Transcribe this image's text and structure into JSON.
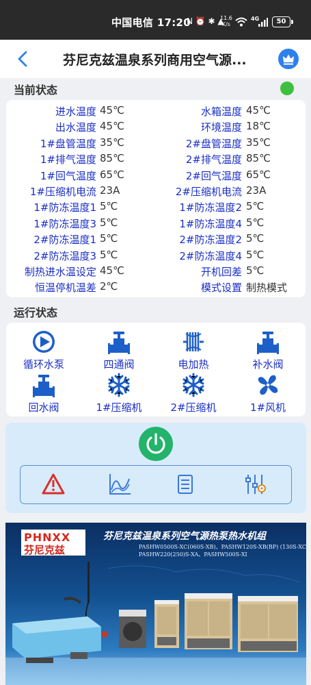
{
  "status_bar": {
    "carrier_time": "中国电信 17:20",
    "icons": "N ⏰ ✱ ▲",
    "speed_value": "11.6",
    "speed_unit": "K/s",
    "network": "4G",
    "battery": "50"
  },
  "app_bar": {
    "title": "芬尼克兹温泉系列商用空气源..."
  },
  "current_status": {
    "label": "当前状态",
    "indicator_color": "#3fbf3f",
    "rows": [
      {
        "left_label": "进水温度",
        "left_value": "45℃",
        "right_label": "水箱温度",
        "right_value": "45℃"
      },
      {
        "left_label": "出水温度",
        "left_value": "45℃",
        "right_label": "环境温度",
        "right_value": "18℃"
      },
      {
        "left_label": "1#盘管温度",
        "left_value": "35℃",
        "right_label": "2#盘管温度",
        "right_value": "35℃"
      },
      {
        "left_label": "1#排气温度",
        "left_value": "85℃",
        "right_label": "2#排气温度",
        "right_value": "85℃"
      },
      {
        "left_label": "1#回气温度",
        "left_value": "65℃",
        "right_label": "2#回气温度",
        "right_value": "65℃"
      },
      {
        "left_label": "1#压缩机电流",
        "left_value": "23A",
        "right_label": "2#压缩机电流",
        "right_value": "23A"
      },
      {
        "left_label": "1#防冻温度1",
        "left_value": "5℃",
        "right_label": "1#防冻温度2",
        "right_value": "5℃"
      },
      {
        "left_label": "1#防冻温度3",
        "left_value": "5℃",
        "right_label": "1#防冻温度4",
        "right_value": "5℃"
      },
      {
        "left_label": "2#防冻温度1",
        "left_value": "5℃",
        "right_label": "2#防冻温度2",
        "right_value": "5℃"
      },
      {
        "left_label": "2#防冻温度3",
        "left_value": "5℃",
        "right_label": "2#防冻温度4",
        "right_value": "5℃"
      },
      {
        "left_label": "制热进水温设定",
        "left_value": "45℃",
        "right_label": "开机回差",
        "right_value": "5℃"
      },
      {
        "left_label": "恒温停机温差",
        "left_value": "2℃",
        "right_label": "模式设置",
        "right_value": "制热模式"
      }
    ]
  },
  "run_status": {
    "label": "运行状态",
    "items": [
      {
        "label": "循环水泵",
        "icon": "circulation-pump-icon"
      },
      {
        "label": "四通阀",
        "icon": "four-way-valve-icon"
      },
      {
        "label": "电加热",
        "icon": "electric-heater-icon"
      },
      {
        "label": "补水阀",
        "icon": "makeup-valve-icon"
      },
      {
        "label": "回水阀",
        "icon": "return-valve-icon"
      },
      {
        "label": "1#压缩机",
        "icon": "snowflake-icon"
      },
      {
        "label": "2#压缩机",
        "icon": "snowflake-icon"
      },
      {
        "label": "1#风机",
        "icon": "fan-icon"
      }
    ],
    "icon_color": "#1c5fc9"
  },
  "controls": {
    "power_color": "#23b36b",
    "tools": [
      "alarm-icon",
      "curve-chart-icon",
      "list-icon",
      "settings-sliders-icon"
    ],
    "alarm_color": "#d9302a",
    "tool_color": "#3a78d8"
  },
  "banner": {
    "logo_en": "PHNXX",
    "logo_cn": "芬尼克兹",
    "title": "芬尼克兹温泉系列空气源热泵热水机组",
    "model_line_1": "PASHW0500S-XC(060S-XB)、PASHW120S-XB(BP) (130S-XC)",
    "model_line_2": "PASHW220(250)S-XA、PASHW500S-XI"
  }
}
